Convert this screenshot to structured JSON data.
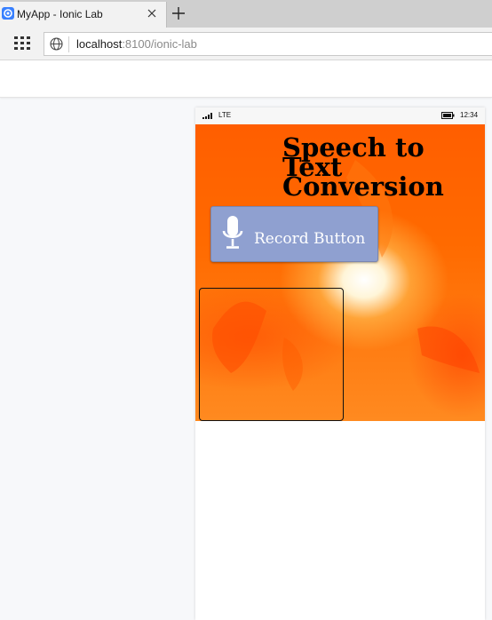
{
  "browser": {
    "tab": {
      "title": "MyApp - Ionic Lab"
    },
    "address": {
      "host": "localhost",
      "rest": ":8100/ionic-lab"
    }
  },
  "device": {
    "status": {
      "network": "LTE",
      "time": "12:34"
    }
  },
  "app": {
    "heading": "Speech to Text Conversion",
    "record_button": {
      "label": "Record Button",
      "icon": "microphone-icon"
    },
    "transcript": ""
  },
  "colors": {
    "tab_bg": "#f2f2f2",
    "background_orange": "#ff5e00",
    "button_bg": "#8fa0d0"
  }
}
